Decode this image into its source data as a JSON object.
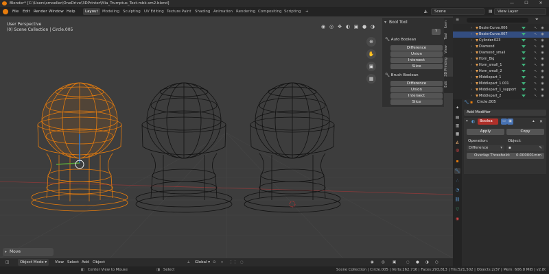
{
  "window": {
    "title": "Blender* [C:\\Users\\smoeller\\OneDrive\\3DPrinter\\Mia_Trumptus_Test-mbk-sm2.blend]",
    "min": "—",
    "max": "☐",
    "close": "✕"
  },
  "menu": [
    "File",
    "Edit",
    "Render",
    "Window",
    "Help"
  ],
  "workspaces": [
    {
      "label": "Layout",
      "active": true
    },
    {
      "label": "Modeling"
    },
    {
      "label": "Sculpting"
    },
    {
      "label": "UV Editing"
    },
    {
      "label": "Texture Paint"
    },
    {
      "label": "Shading"
    },
    {
      "label": "Animation"
    },
    {
      "label": "Rendering"
    },
    {
      "label": "Compositing"
    },
    {
      "label": "Scripting"
    },
    {
      "label": "+"
    }
  ],
  "scene": {
    "label": "Scene"
  },
  "view_layer": {
    "label": "View Layer"
  },
  "viewport": {
    "perspective": "User Perspective",
    "collection": "(0) Scene Collection | Circle.005"
  },
  "bool_tool": {
    "title": "Bool Tool",
    "help": "?",
    "auto_label": "Auto Boolean",
    "auto_buttons": [
      "Difference",
      "Union",
      "Intersect",
      "Slice"
    ],
    "brush_label": "Brush Boolean",
    "brush_buttons": [
      "Difference",
      "Union",
      "Intersect",
      "Slice"
    ]
  },
  "side_tabs": [
    "Item",
    "Tool",
    "View",
    "3D Printing",
    "Edit"
  ],
  "move_panel": {
    "label": "Move"
  },
  "viewport_header": {
    "mode": "Object Mode",
    "menus": [
      "View",
      "Select",
      "Add",
      "Object"
    ],
    "transform": "Global"
  },
  "outliner": {
    "items": [
      {
        "name": "BezierCurve.006"
      },
      {
        "name": "BezierCurve.007",
        "selected": true
      },
      {
        "name": "Cylinder.023"
      },
      {
        "name": "Diamond"
      },
      {
        "name": "Diamond_small"
      },
      {
        "name": "Horn_Big"
      },
      {
        "name": "Horn_small_1"
      },
      {
        "name": "Horn_small_2"
      },
      {
        "name": "Middlepart_1"
      },
      {
        "name": "Middlepart_1.001"
      },
      {
        "name": "Middlepart_1_support"
      },
      {
        "name": "Middlepart_2"
      }
    ]
  },
  "properties": {
    "object": "Circle.005",
    "add_modifier": "Add Modifier",
    "modifier_name": "Boolea",
    "apply": "Apply",
    "copy": "Copy",
    "operation_label": "Operation:",
    "object_label": "Object:",
    "operation_value": "Difference",
    "overlap_label": "Overlap Threshold:",
    "overlap_value": "0.000001mm"
  },
  "statusbar": {
    "center_view": "Center View to Mouse",
    "select": "Select",
    "stats": "Scene Collection | Circle.005 | Verts:262,716 | Faces:293,813 | Tris:521,502 | Objects:2/37 | Mem: 606.8 MiB | v2.80.75"
  },
  "colors": {
    "selected_wire": "#e87d0d",
    "wire": "#111111",
    "viewport_bg": "#3d3d3d",
    "accent": "#334d80",
    "modifier_red": "#b0302a"
  }
}
